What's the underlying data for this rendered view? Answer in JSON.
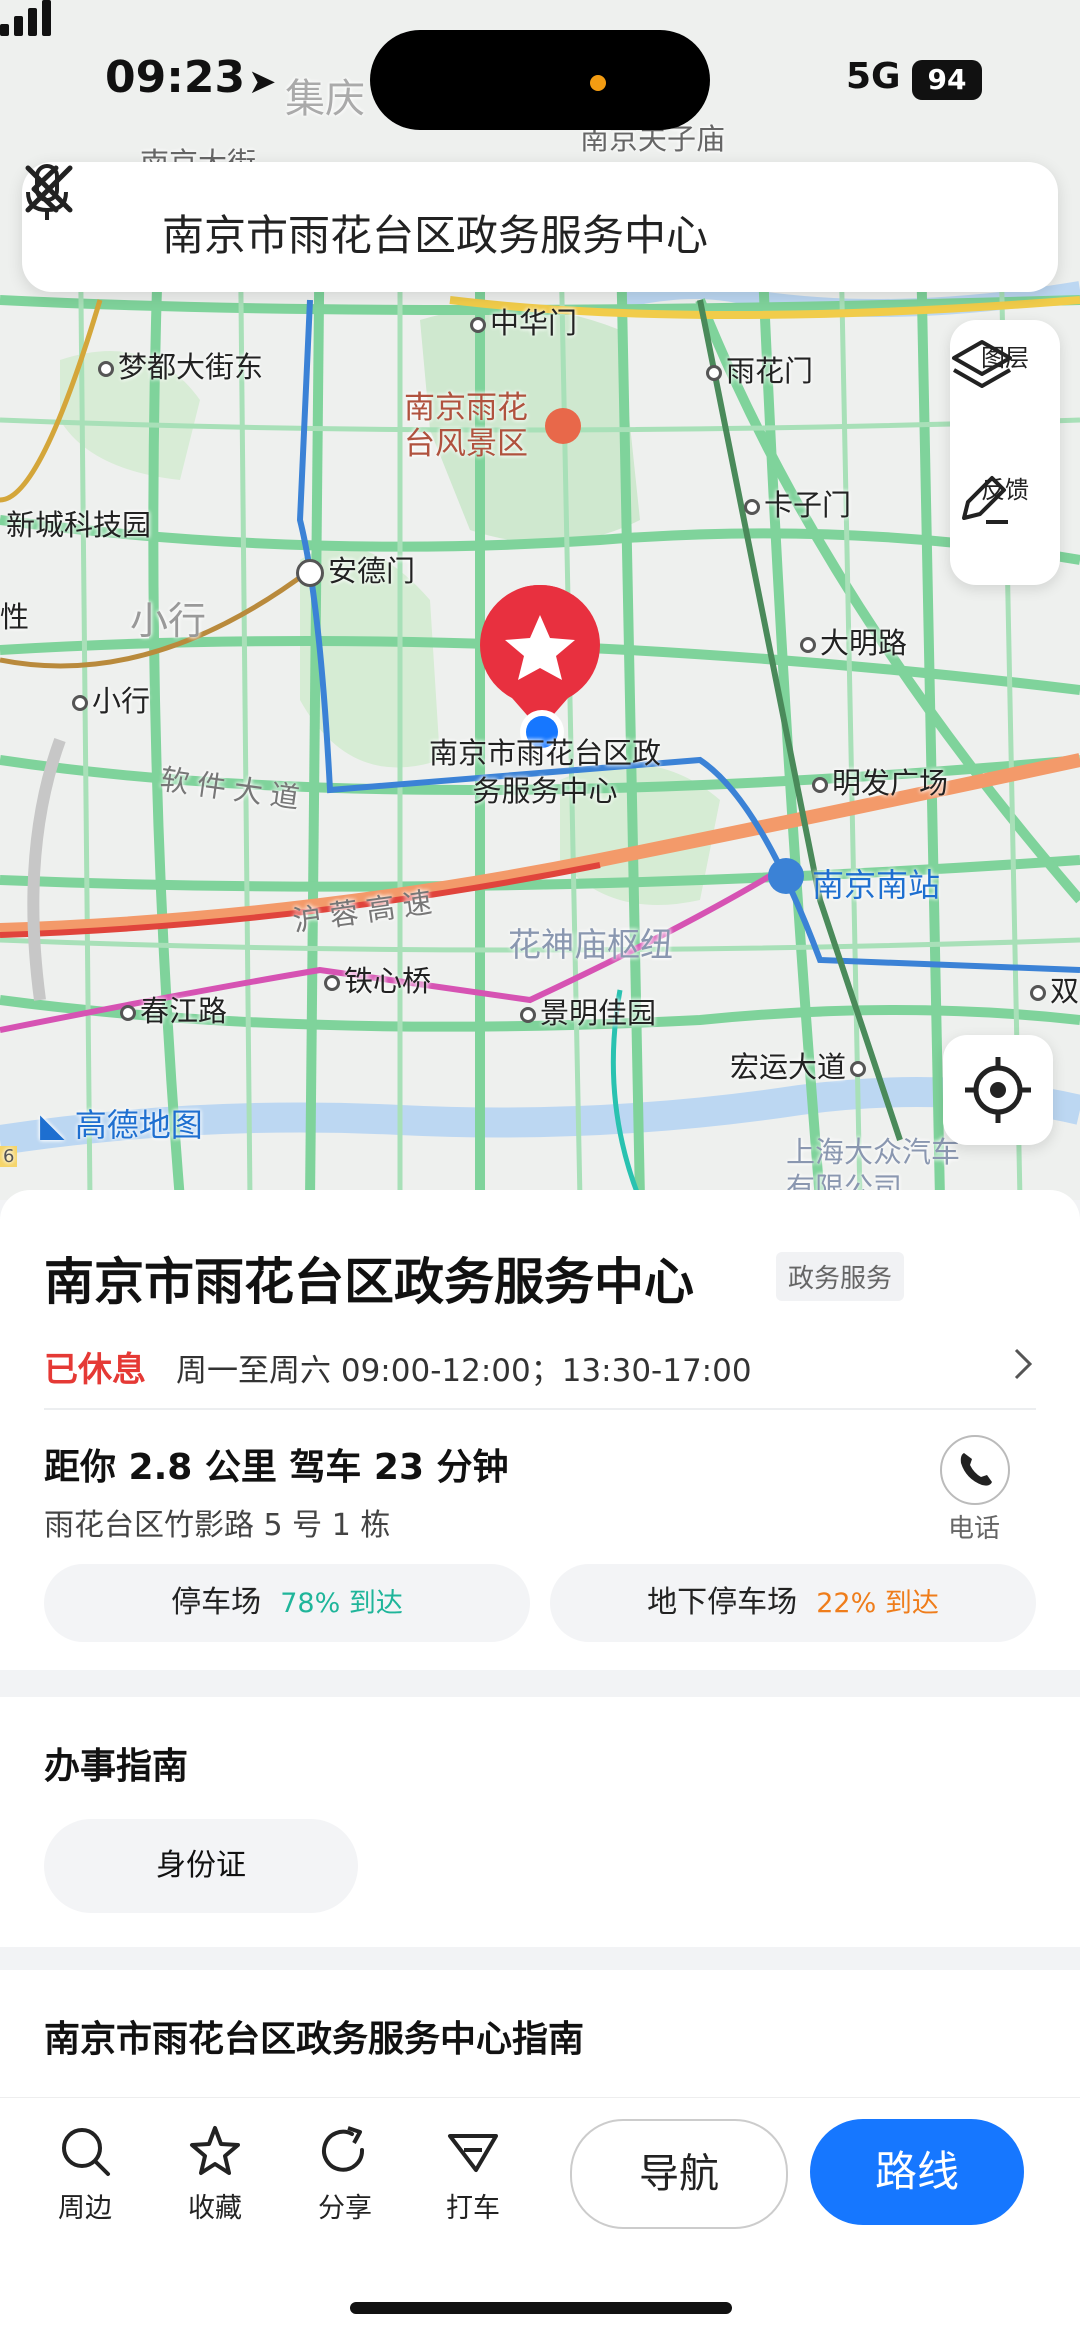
{
  "status": {
    "time": "09:23",
    "network": "5G",
    "battery": "94"
  },
  "search": {
    "query": "南京市雨花台区政务服务中心"
  },
  "map_tools": {
    "layers": "图层",
    "feedback": "反馈"
  },
  "map_labels": {
    "jiqing": "集庆",
    "fuzimiao": "南京夫子庙",
    "dahualu": "南京大街",
    "zhonghuamen": "中华门",
    "mengdu": "梦都大街东",
    "yuhuamen": "雨花门",
    "scenic": "南京雨花台风景区",
    "kazimen": "卡子门",
    "xincheng": "新城科技园",
    "andemen": "安德门",
    "xiaohang_area": "小行",
    "xing": "性",
    "daminglu": "大明路",
    "xiaohang": "小行",
    "poi_marker": "南京市雨花台区政务服务中心",
    "ruanjian": "软件大道",
    "mingfa": "明发广场",
    "nanjingnan": "南京南站",
    "hurong": "沪蓉高速",
    "huashen": "花神庙枢纽",
    "chunjiang": "春江路",
    "tiexinqiao": "铁心桥",
    "jingming": "景明佳园",
    "hongyun": "宏运大道",
    "shuang": "双",
    "shanghai": "上海大众汽车有限公司",
    "amap": "高德地图",
    "edge6": "6"
  },
  "poi": {
    "name": "南京市雨花台区政务服务中心",
    "category": "政务服务",
    "status": "已休息",
    "hours": "周一至周六 09:00-12:00；13:30-17:00",
    "distance": "距你 2.8 公里   驾车 23 分钟",
    "address": "雨花台区竹影路 5 号 1 栋",
    "phone_label": "电话",
    "parking": [
      {
        "name": "停车场",
        "pct": "78% 到达"
      },
      {
        "name": "地下停车场",
        "pct": "22% 到达"
      }
    ]
  },
  "guide": {
    "title": "办事指南",
    "chip": "身份证"
  },
  "guide2": {
    "title": "南京市雨花台区政务服务中心指南"
  },
  "bottom": {
    "nearby": "周边",
    "favorite": "收藏",
    "share": "分享",
    "taxi": "打车",
    "navigate": "导航",
    "route": "路线"
  },
  "colors": {
    "accent": "#1677ff",
    "closed": "#e53935",
    "marker": "#e8303f"
  }
}
